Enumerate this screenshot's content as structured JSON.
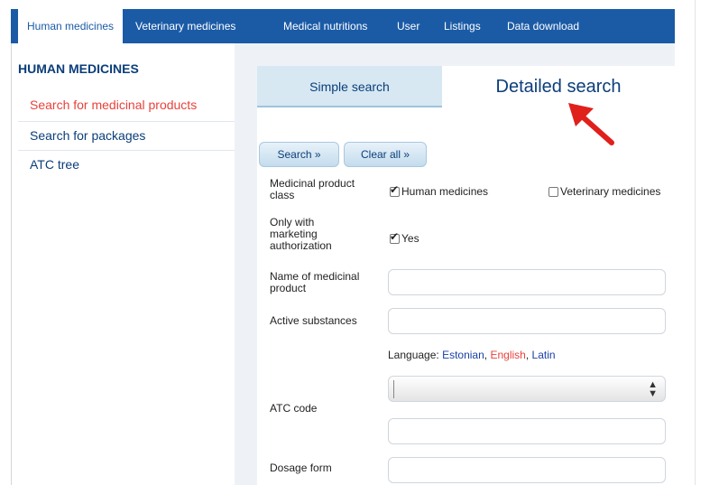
{
  "topnav": {
    "tabs": [
      {
        "label": "Human medicines",
        "active": true
      },
      {
        "label": "Veterinary medicines",
        "active": false
      },
      {
        "label": "Medical nutritions",
        "active": false
      },
      {
        "label": "User",
        "active": false
      },
      {
        "label": "Listings",
        "active": false
      },
      {
        "label": "Data download",
        "active": false
      }
    ]
  },
  "sidebar": {
    "heading": "HUMAN MEDICINES",
    "items": [
      {
        "label": "Search for medicinal products",
        "active": true
      },
      {
        "label": "Search for packages",
        "active": false
      },
      {
        "label": "ATC tree",
        "active": false
      }
    ]
  },
  "search_tabs": {
    "simple": "Simple search",
    "detailed": "Detailed search",
    "active": "detailed"
  },
  "buttons": {
    "search": "Search »",
    "clear": "Clear all »"
  },
  "form": {
    "product_class": {
      "label": "Medicinal product class",
      "options": [
        {
          "label": "Human medicines",
          "checked": true
        },
        {
          "label": "Veterinary medicines",
          "checked": false
        }
      ]
    },
    "marketing_auth": {
      "label": "Only with marketing authorization",
      "option": {
        "label": "Yes",
        "checked": true
      }
    },
    "name": {
      "label": "Name of medicinal product",
      "value": ""
    },
    "active_substances": {
      "label": "Active substances",
      "value": ""
    },
    "language": {
      "prefix": "Language:",
      "options": [
        "Estonian",
        "English",
        "Latin"
      ],
      "active": "English"
    },
    "atc": {
      "label": "ATC code",
      "selected": "",
      "value": ""
    },
    "dosage": {
      "label": "Dosage form",
      "value": ""
    }
  },
  "colors": {
    "nav_blue": "#1b5ba6",
    "link_blue": "#0b3e7a",
    "active_red": "#e8423b",
    "arrow_red": "#e0201b"
  },
  "icons": {
    "checkbox": "checkmark-icon",
    "select": "select-arrows-icon",
    "annotation": "red-arrow-icon"
  }
}
